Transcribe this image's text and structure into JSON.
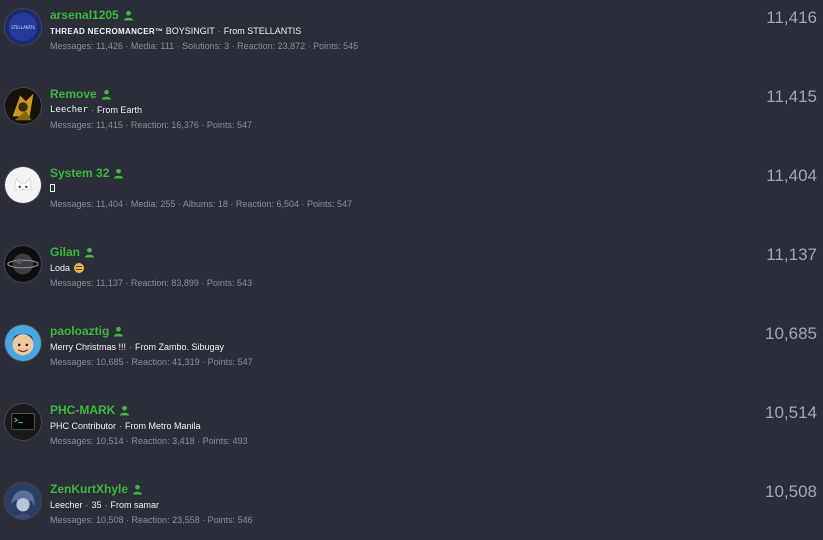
{
  "members": [
    {
      "username": "arsenal1205",
      "title_prefix": "THREAD NECROMANCER™",
      "title": "BOYSINGIT",
      "location": "From STELLANTIS",
      "stats": "Messages: 11,426 · Media: 111 · Solutions: 3 · Reaction: 23,872 · Points: 545",
      "count": "11,416",
      "avatar_icon": "stellantis-logo-avatar"
    },
    {
      "username": "Remove",
      "title": "Leecher",
      "location": "From Earth",
      "stats": "Messages: 11,415 · Reaction: 16,376 · Points: 547",
      "count": "11,415",
      "avatar_icon": "character-avatar"
    },
    {
      "username": "System 32",
      "title": "",
      "stats": "Messages: 11,404 · Media: 255 · Albums: 18 · Reaction: 6,504 · Points: 547",
      "count": "11,404",
      "avatar_icon": "cute-cat-avatar"
    },
    {
      "username": "Gilan",
      "title": "Loda",
      "stats": "Messages: 11,137 · Reaction: 83,899 · Points: 543",
      "count": "11,137",
      "avatar_icon": "dark-planet-avatar"
    },
    {
      "username": "paoloaztig",
      "title": "Merry Christmas !!!",
      "location": "From Zambo. Sibugay",
      "stats": "Messages: 10,685 · Reaction: 41,319 · Points: 547",
      "count": "10,685",
      "avatar_icon": "cartoon-face-avatar"
    },
    {
      "username": "PHC-MARK",
      "title": "PHC Contributor",
      "location": "From Metro Manila",
      "stats": "Messages: 10,514 · Reaction: 3,418 · Points: 493",
      "count": "10,514",
      "avatar_icon": "terminal-avatar"
    },
    {
      "username": "ZenKurtXhyle",
      "title": "Leecher",
      "age": "35",
      "location": "From samar",
      "stats": "Messages: 10,508 · Reaction: 23,558 · Points: 546",
      "count": "10,508",
      "avatar_icon": "anime-character-avatar"
    }
  ],
  "colors": {
    "background": "#2b2d38",
    "username": "#3db93d",
    "title_text": "#f2f2f4",
    "stats_text": "#8d8f9c",
    "count_text": "#a4a6b2"
  }
}
